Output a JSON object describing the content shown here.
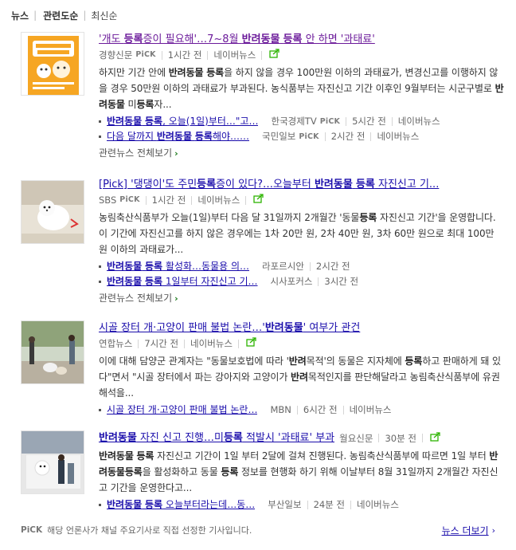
{
  "sort": {
    "news_label": "뉴스",
    "related_label": "관련도순",
    "latest_label": "최신순"
  },
  "pick_label": "PiCK",
  "naver_news_label": "네이버뉴스",
  "all_related_label": "관련뉴스 전체보기",
  "articles": [
    {
      "title": "'개도 등록증이 필요해'…7~8월 반려동물 등록 안 하면 '과태료'",
      "source": "경향신문",
      "time": "1시간 전",
      "desc": "하지만 기간 안에 반려동물 등록을 하지 않을 경우 100만원 이하의 과태료가, 변경신고를 이행하지 않을 경우 50만원 이하의 과태료가 부과된다. 농식품부는 자진신고 기간 이후인 9월부터는 시군구별로 반려동물 미등록자...",
      "related": [
        {
          "title": "반려동물 등록, 오늘(1일)부터…\"고…",
          "source": "한국경제TV",
          "pick": true,
          "time": "5시간 전"
        },
        {
          "title": "다음 달까지 반려동물 등록해야……",
          "source": "국민일보",
          "pick": true,
          "time": "2시간 전"
        }
      ]
    },
    {
      "title": "[Pick] '댕댕이'도 주민등록증이 있다?…오늘부터 반려동물 등록 자진신고 기...",
      "source": "SBS",
      "time": "1시간 전",
      "desc": "농림축산식품부가 오늘(1일)부터 다음 달 31일까지 2개월간 '동물등록 자진신고 기간'을 운영합니다. 이 기간에 자진신고를 하지 않은 경우에는 1차 20만 원, 2차 40만 원, 3차 60만 원으로 최대 100만 원 이하의 과태료가...",
      "related": [
        {
          "title": "반려동물 등록 활성화…동물용 의…",
          "source": "라포르시안",
          "pick": false,
          "time": "2시간 전"
        },
        {
          "title": "반려동물 등록 1일부터 자진신고 기…",
          "source": "시사포커스",
          "pick": false,
          "time": "3시간 전"
        }
      ]
    },
    {
      "title": "시골 장터 개·고양이 판매 불법 논란…'반려동물' 여부가 관건",
      "source": "연합뉴스",
      "time": "7시간 전",
      "desc": "이에 대해 담양군 관계자는 \"동물보호법에 따라 '반려목적'의 동물은 지자체에 등록하고 판매하게 돼 있다\"면서 \"시골 장터에서 파는 강아지와 고양이가 반려목적인지를 판단해달라고 농림축산식품부에 유권해석을...",
      "related": [
        {
          "title": "시골 장터 개·고양이 판매 불법 논란…",
          "source": "MBN",
          "pick": false,
          "time": "6시간 전"
        }
      ]
    },
    {
      "title": "반려동물 자진 신고 진행…미등록 적발시 '과태료' 부과",
      "source": "월요신문",
      "time": "30분 전",
      "desc": "반려동물 등록 자진신고 기간이 1일 부터 2달에 걸쳐 진행된다. 농림축산식품부에 따르면 1일 부터 반려동물등록을 활성화하고 동물 등록 정보를 현행화 하기 위해 이날부터 8월 31일까지 2개월간 자진신고 기간을 운영한다고...",
      "related": [
        {
          "title": "반려동물 등록 오늘부터라는데…동…",
          "source": "부산일보",
          "pick": false,
          "time": "24분 전"
        }
      ]
    }
  ],
  "footer": {
    "text": "해당 언론사가 채널 주요기사로 직접 선정한 기사입니다.",
    "more_label": "뉴스 더보기"
  },
  "colors": {
    "link": "#1a0dab",
    "visited": "#6b1a9a",
    "share_icon": "#2db400"
  }
}
